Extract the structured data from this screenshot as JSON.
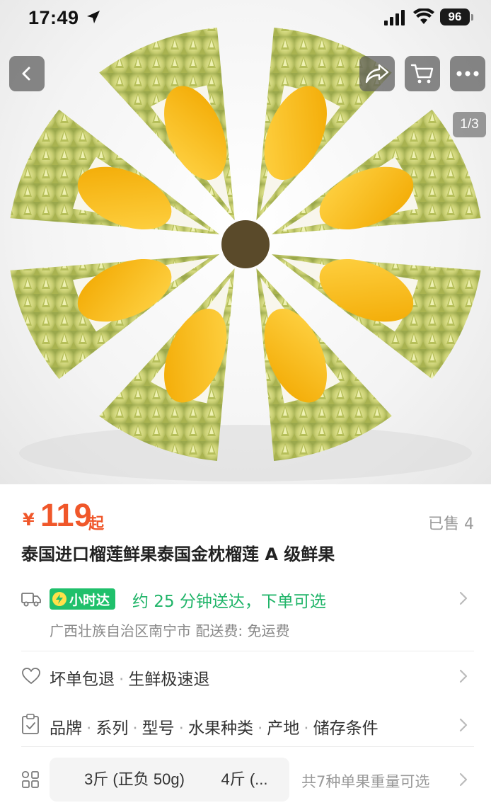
{
  "status_bar": {
    "time": "17:49",
    "battery": "96"
  },
  "gallery": {
    "counter": "1/3",
    "image_subject": "durian"
  },
  "icons": {
    "back": "chevron-left-icon",
    "share": "share-icon",
    "cart": "cart-icon",
    "more": "more-icon",
    "delivery": "truck-icon",
    "service": "heart-icon",
    "params": "clipboard-icon",
    "spec": "grid-icon",
    "chevron": "chevron-right-icon"
  },
  "colors": {
    "price": "#f0572a",
    "delivery_green": "#1fc06b",
    "badge_bolt": "#ffe14a"
  },
  "product": {
    "price_symbol": "¥",
    "price": "119",
    "price_suffix": "起",
    "sold": "已售 4",
    "title": "泰国进口榴莲鲜果泰国金枕榴莲 A 级鲜果"
  },
  "delivery": {
    "badge": "小时达",
    "text": "约 25 分钟送达，下单可选",
    "sub": "广西壮族自治区南宁市  配送费: 免运费"
  },
  "service": {
    "items": [
      "坏单包退",
      "生鲜极速退"
    ]
  },
  "params": {
    "items": [
      "品牌",
      "系列",
      "型号",
      "水果种类",
      "产地",
      "储存条件"
    ]
  },
  "spec": {
    "options": [
      "3斤 (正负 50g)",
      "4斤 (..."
    ],
    "more": "共7种单果重量可选"
  }
}
